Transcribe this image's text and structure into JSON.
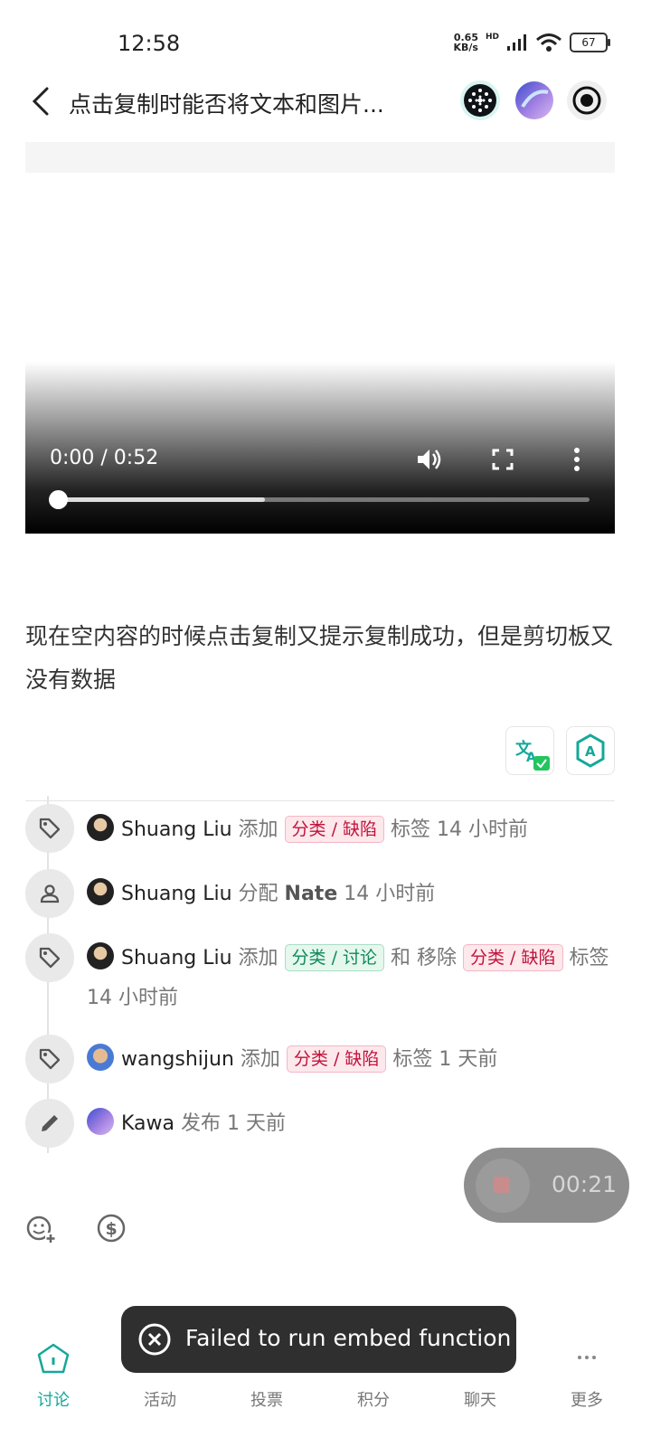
{
  "status_bar": {
    "time": "12:58",
    "net_speed": "0.65",
    "net_unit": "KB/s",
    "net_type": "HD",
    "battery": "67"
  },
  "header": {
    "title": "点击复制时能否将文本和图片..."
  },
  "video": {
    "time": "0:00 / 0:52",
    "progress_fraction": 0,
    "buffered_fraction": 0.39
  },
  "post": {
    "body": "现在空内容的时候点击复制又提示复制成功，但是剪切板又没有数据"
  },
  "timeline": [
    {
      "icon": "tag-icon",
      "user": "Shuang Liu",
      "parts": [
        {
          "t": "text",
          "v": " 添加 "
        },
        {
          "t": "tag-red",
          "v": "分类 / 缺陷"
        },
        {
          "t": "text",
          "v": " 标签 14 小时前"
        }
      ]
    },
    {
      "icon": "person-icon",
      "user": "Shuang Liu",
      "parts": [
        {
          "t": "text",
          "v": " 分配 "
        },
        {
          "t": "strong",
          "v": "Nate"
        },
        {
          "t": "text",
          "v": " 14 小时前"
        }
      ]
    },
    {
      "icon": "tag-icon",
      "user": "Shuang Liu",
      "parts": [
        {
          "t": "text",
          "v": " 添加 "
        },
        {
          "t": "tag-green",
          "v": "分类 / 讨论"
        },
        {
          "t": "text",
          "v": " 和 移除 "
        },
        {
          "t": "tag-red",
          "v": "分类 / 缺陷"
        },
        {
          "t": "text",
          "v": " 标签 14 小时前"
        }
      ]
    },
    {
      "icon": "tag-icon",
      "user": "wangshijun",
      "parts": [
        {
          "t": "text",
          "v": " 添加 "
        },
        {
          "t": "tag-red",
          "v": "分类 / 缺陷"
        },
        {
          "t": "text",
          "v": " 标签 1 天前"
        }
      ]
    },
    {
      "icon": "pencil-icon",
      "user": "Kawa",
      "parts": [
        {
          "t": "text",
          "v": " 发布 1 天前"
        }
      ]
    }
  ],
  "recording": {
    "time": "00:21"
  },
  "toast": {
    "message": "Failed to run embed function"
  },
  "bottom_nav": {
    "items": [
      {
        "label": "讨论",
        "icon": "home-pentagon-icon",
        "active": true
      },
      {
        "label": "活动",
        "icon": "",
        "active": false
      },
      {
        "label": "投票",
        "icon": "",
        "active": false
      },
      {
        "label": "积分",
        "icon": "",
        "active": false
      },
      {
        "label": "聊天",
        "icon": "",
        "active": false
      },
      {
        "label": "更多",
        "icon": "more-dots-icon",
        "active": false
      }
    ]
  },
  "colors": {
    "accent": "#14a89a",
    "tag_red": "#c0143c",
    "tag_green": "#0e8a5a"
  }
}
